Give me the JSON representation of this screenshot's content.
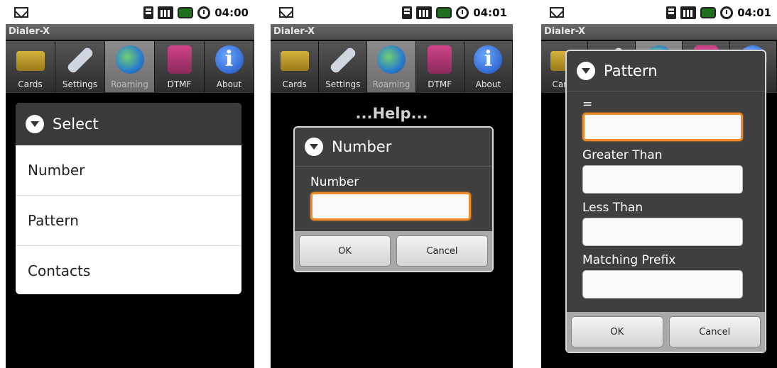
{
  "status": [
    {
      "time": "04:00"
    },
    {
      "time": "04:01"
    },
    {
      "time": "04:01"
    }
  ],
  "app_title": "Dialer-X",
  "tabs": [
    "Cards",
    "Settings",
    "Roaming",
    "DTMF",
    "About"
  ],
  "help_text": "...Help...",
  "select_dialog": {
    "title": "Select",
    "items": [
      "Number",
      "Pattern",
      "Contacts"
    ]
  },
  "number_dialog": {
    "title": "Number",
    "field_label": "Number",
    "ok": "OK",
    "cancel": "Cancel"
  },
  "pattern_dialog": {
    "title": "Pattern",
    "fields": [
      "=",
      "Greater Than",
      "Less Than",
      "Matching Prefix"
    ],
    "ok": "OK",
    "cancel": "Cancel"
  },
  "colors": {
    "focus": "#f08a24",
    "dialog_bg": "#3f3f3f"
  },
  "icons": {
    "mail": "gmail-icon",
    "wifi": "signal-icon",
    "bars": "cell-bars-icon",
    "battery": "battery-icon",
    "alarm": "alarm-icon"
  }
}
